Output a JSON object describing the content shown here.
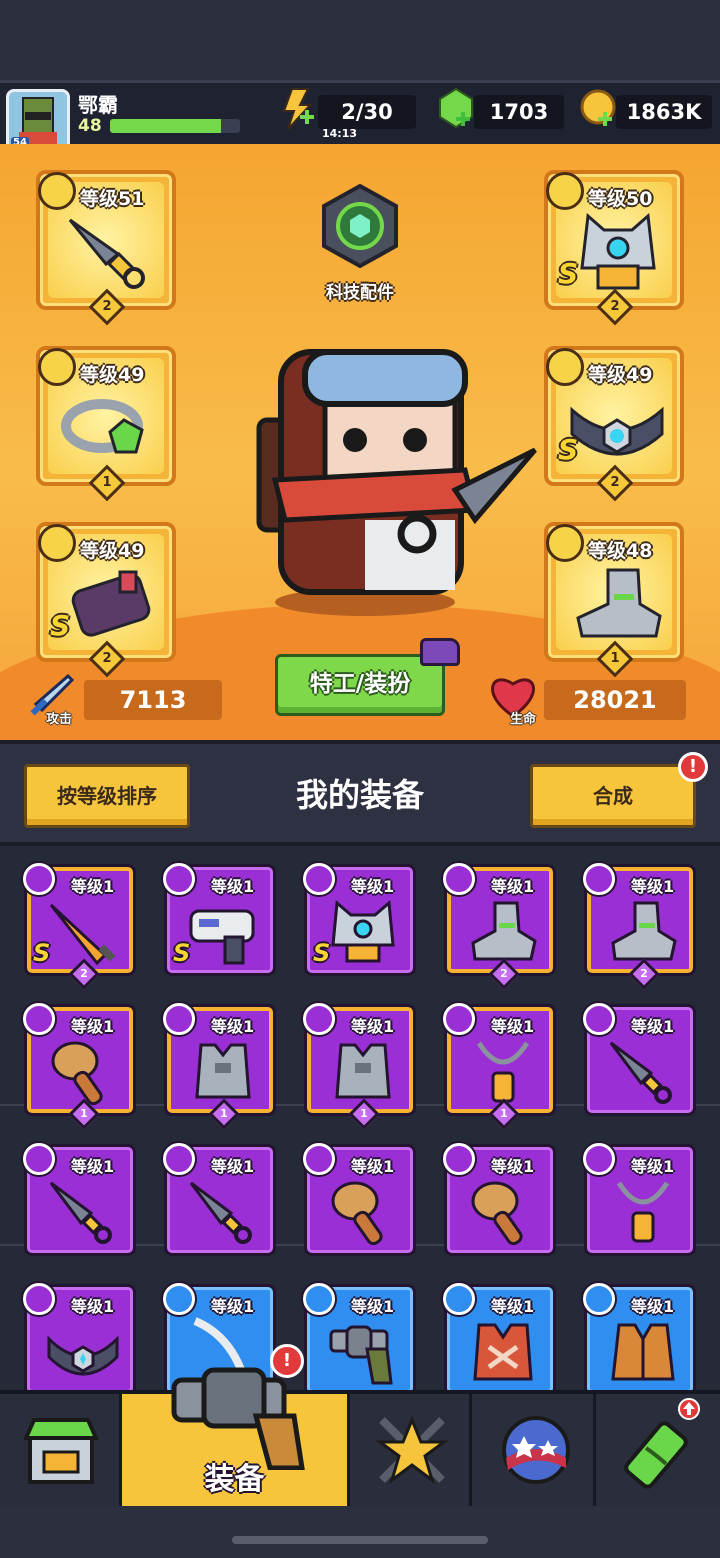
{
  "player": {
    "name": "鄂霸",
    "level": "48",
    "avatar_level": "54",
    "xp_fraction": 0.85
  },
  "resources": {
    "energy": "2/30",
    "energy_timer": "14:13",
    "gems": "1703",
    "coins": "1863K"
  },
  "equipped": {
    "slots": [
      {
        "level": "等级51",
        "count": "2",
        "s": "",
        "icon": "kunai-icon",
        "type": "weapon-type-icon"
      },
      {
        "level": "等级49",
        "count": "1",
        "s": "",
        "icon": "ring-icon",
        "type": "necklace-type-icon"
      },
      {
        "level": "等级49",
        "count": "2",
        "s": "S",
        "icon": "gauntlet-icon",
        "type": "glove-type-icon"
      },
      {
        "level": "等级50",
        "count": "2",
        "s": "S",
        "icon": "robot-armor-icon",
        "type": "armor-type-icon"
      },
      {
        "level": "等级49",
        "count": "2",
        "s": "S",
        "icon": "belt-icon",
        "type": "belt-type-icon"
      },
      {
        "level": "等级48",
        "count": "1",
        "s": "",
        "icon": "boots-icon",
        "type": "boots-type-icon"
      }
    ],
    "tech_label": "科技配件",
    "attack_label": "攻击",
    "attack": "7113",
    "hp_label": "生命",
    "hp": "28021",
    "agent_button": "特工/装扮"
  },
  "panel": {
    "sort_button": "按等级排序",
    "title": "我的装备",
    "merge_button": "合成",
    "alert": "!"
  },
  "inventory": [
    {
      "level": "等级1",
      "s": "S",
      "count": "2",
      "color": "purple",
      "gold": true,
      "icon": "flame-sword-icon"
    },
    {
      "level": "等级1",
      "s": "S",
      "count": "",
      "color": "purple",
      "gold": false,
      "icon": "laser-gun-icon"
    },
    {
      "level": "等级1",
      "s": "S",
      "count": "",
      "color": "purple",
      "gold": false,
      "icon": "robot-armor-icon"
    },
    {
      "level": "等级1",
      "s": "",
      "count": "2",
      "color": "purple",
      "gold": true,
      "icon": "boots-icon"
    },
    {
      "level": "等级1",
      "s": "",
      "count": "2",
      "color": "purple",
      "gold": true,
      "icon": "boots-icon"
    },
    {
      "level": "等级1",
      "s": "",
      "count": "1",
      "color": "purple",
      "gold": true,
      "icon": "drumstick-icon"
    },
    {
      "level": "等级1",
      "s": "",
      "count": "1",
      "color": "purple",
      "gold": true,
      "icon": "vest-icon"
    },
    {
      "level": "等级1",
      "s": "",
      "count": "1",
      "color": "purple",
      "gold": true,
      "icon": "vest-icon"
    },
    {
      "level": "等级1",
      "s": "",
      "count": "1",
      "color": "purple",
      "gold": true,
      "icon": "amulet-icon"
    },
    {
      "level": "等级1",
      "s": "",
      "count": "",
      "color": "purple",
      "gold": false,
      "icon": "kunai-icon"
    },
    {
      "level": "等级1",
      "s": "",
      "count": "",
      "color": "purple",
      "gold": false,
      "icon": "kunai-icon"
    },
    {
      "level": "等级1",
      "s": "",
      "count": "",
      "color": "purple",
      "gold": false,
      "icon": "kunai-icon"
    },
    {
      "level": "等级1",
      "s": "",
      "count": "",
      "color": "purple",
      "gold": false,
      "icon": "drumstick-icon"
    },
    {
      "level": "等级1",
      "s": "",
      "count": "",
      "color": "purple",
      "gold": false,
      "icon": "drumstick-icon"
    },
    {
      "level": "等级1",
      "s": "",
      "count": "",
      "color": "purple",
      "gold": false,
      "icon": "amulet-icon"
    },
    {
      "level": "等级1",
      "s": "",
      "count": "",
      "color": "purple",
      "gold": false,
      "icon": "belt-icon"
    },
    {
      "level": "等级1",
      "s": "",
      "count": "",
      "color": "blue",
      "gold": false,
      "icon": "saber-icon"
    },
    {
      "level": "等级1",
      "s": "",
      "count": "",
      "color": "blue",
      "gold": false,
      "icon": "revolver-icon"
    },
    {
      "level": "等级1",
      "s": "",
      "count": "",
      "color": "blue",
      "gold": false,
      "icon": "red-vest-icon"
    },
    {
      "level": "等级1",
      "s": "",
      "count": "",
      "color": "blue",
      "gold": false,
      "icon": "jacket-icon"
    }
  ],
  "nav": {
    "items": [
      {
        "name": "nav-shop",
        "label": "",
        "icon": "shop-icon"
      },
      {
        "name": "nav-equipment",
        "label": "装备",
        "icon": "revolver-icon"
      },
      {
        "name": "nav-heroes",
        "label": "",
        "icon": "star-swords-icon"
      },
      {
        "name": "nav-challenge",
        "label": "",
        "icon": "planet-icon"
      },
      {
        "name": "nav-lab",
        "label": "",
        "icon": "dna-vial-icon"
      }
    ]
  },
  "colors": {
    "purple": "#9a2fd6",
    "blue": "#2f8ef0",
    "gold": "#f6c53c",
    "green": "#7fd84a"
  }
}
